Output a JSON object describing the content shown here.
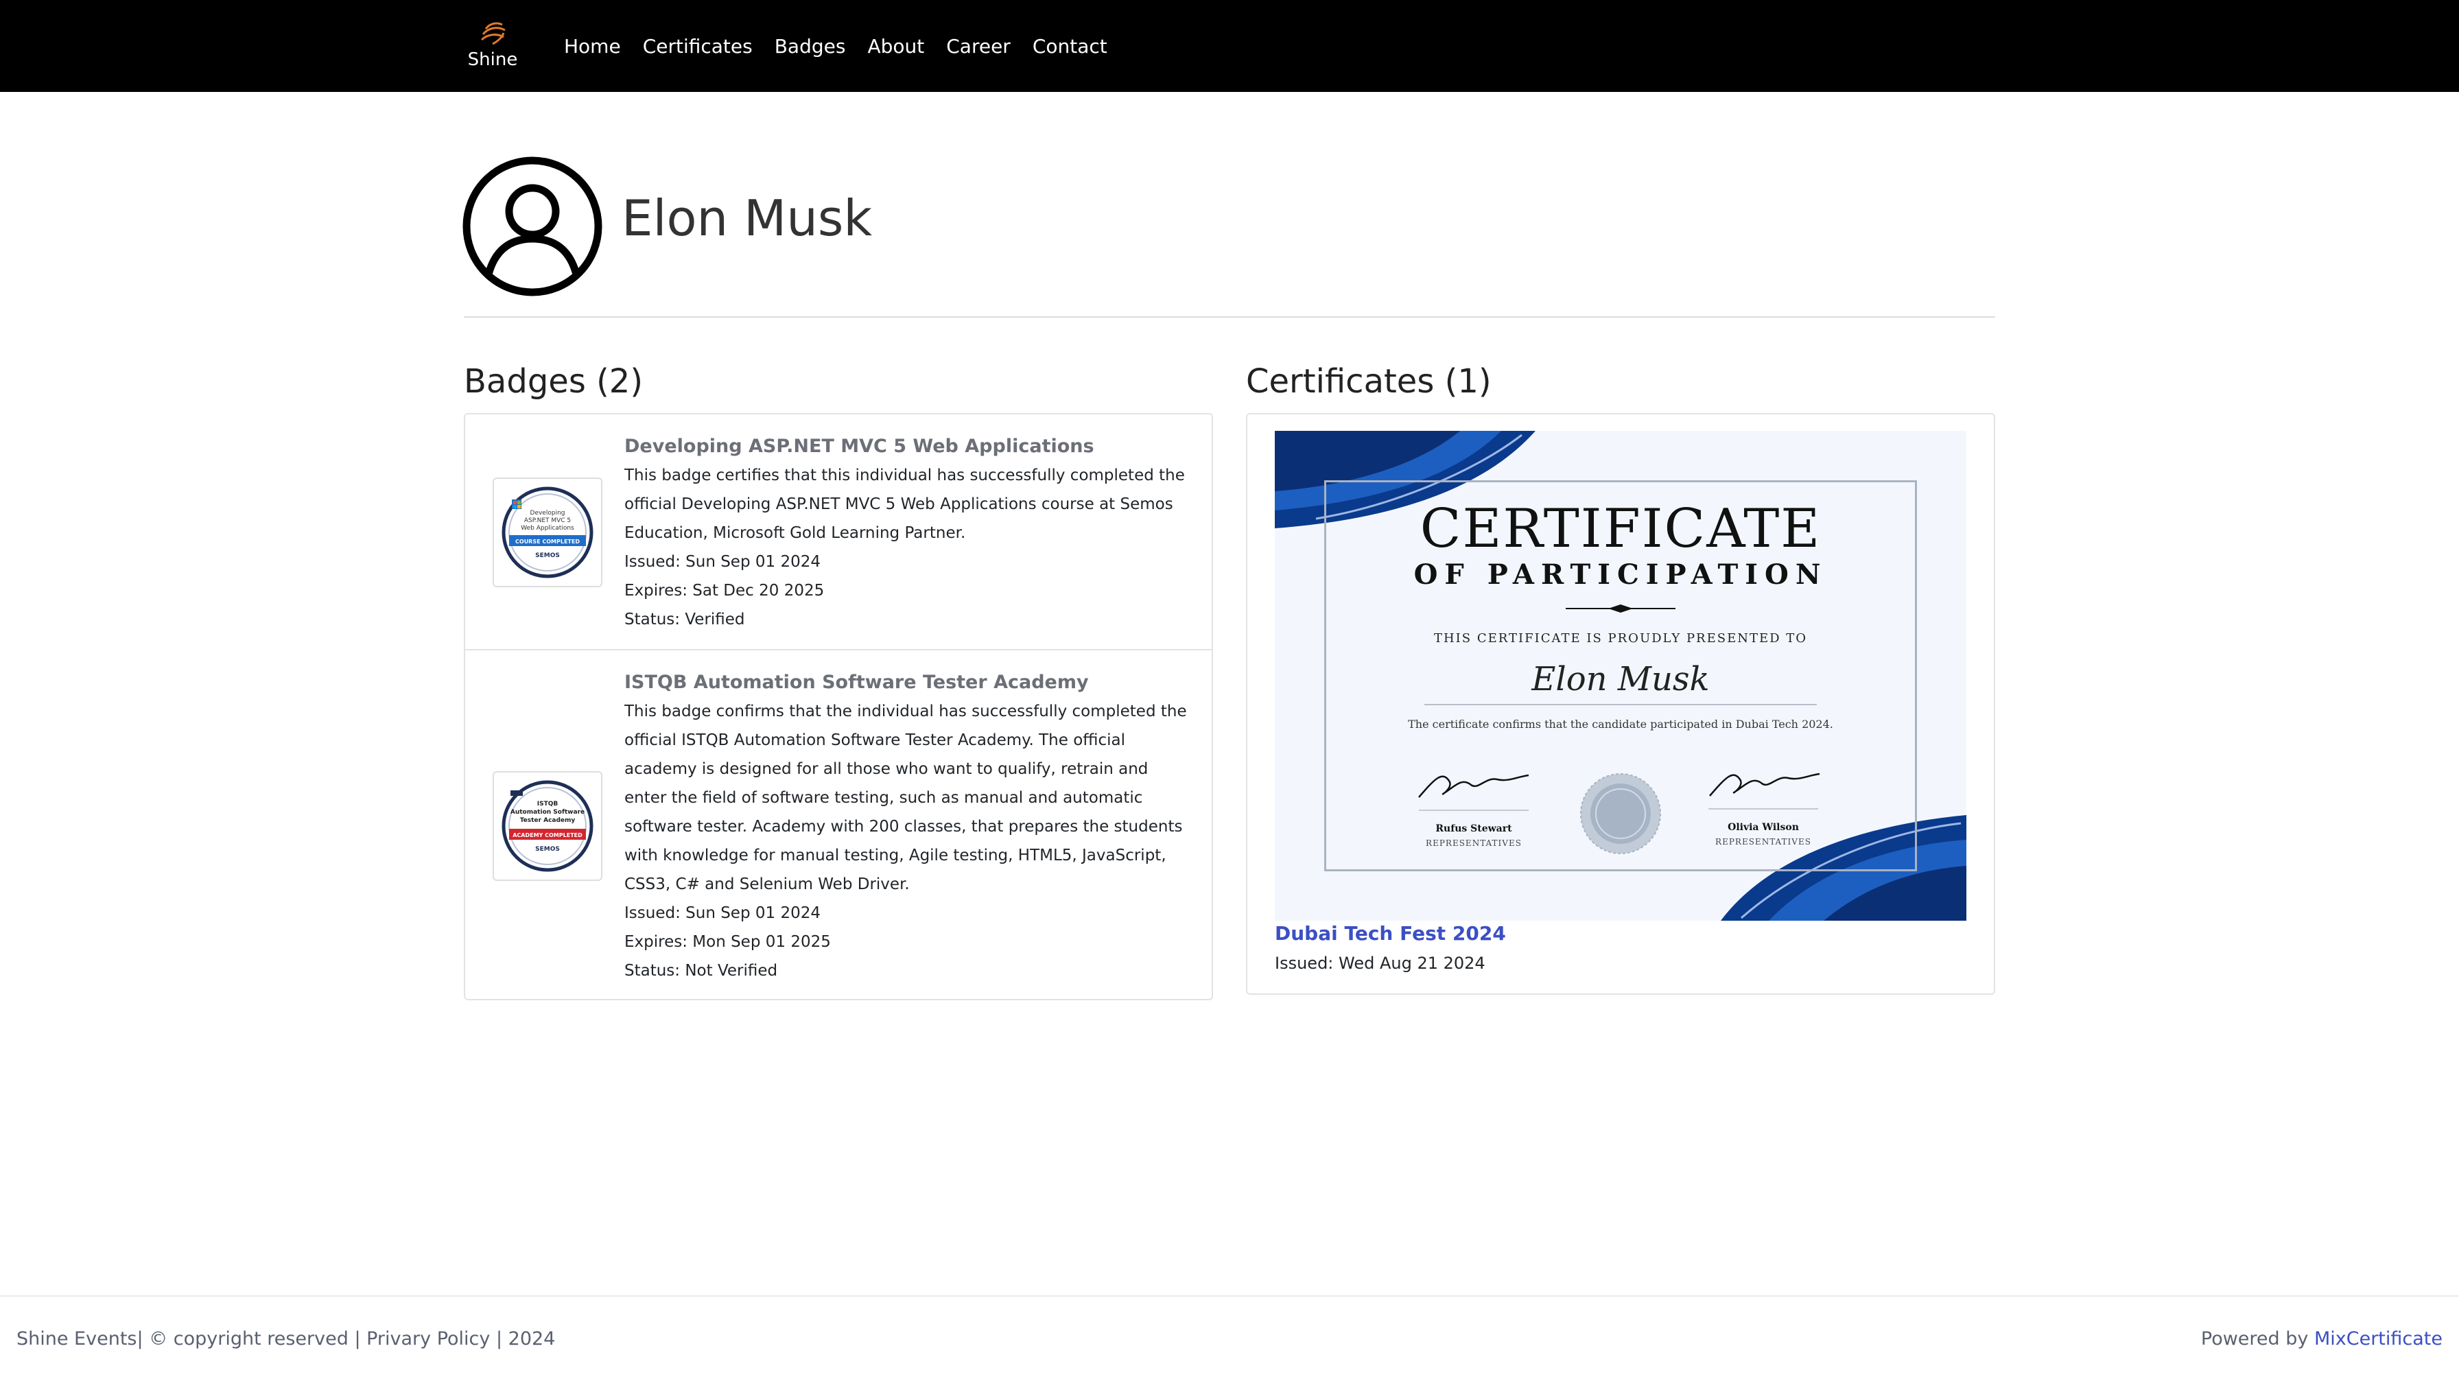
{
  "nav": {
    "brand": "Shine",
    "links": [
      "Home",
      "Certificates",
      "Badges",
      "About",
      "Career",
      "Contact"
    ]
  },
  "profile": {
    "name": "Elon Musk"
  },
  "badges": {
    "heading": "Badges (2)",
    "items": [
      {
        "title": "Developing ASP.NET MVC 5 Web Applications",
        "description": "This badge certifies that this individual has successfully completed the official Developing ASP.NET MVC 5 Web Applications course at Semos Education, Microsoft Gold Learning Partner.",
        "issued": "Issued: Sun Sep 01 2024",
        "expires": "Expires: Sat Dec 20 2025",
        "status": "Status: Verified",
        "image_text": [
          "Developing",
          "ASP.NET MVC 5",
          "Web Applications"
        ],
        "image_band": "COURSE COMPLETED",
        "image_org": "SEMOS",
        "band_color": "#1f6fc9"
      },
      {
        "title": "ISTQB Automation Software Tester Academy",
        "description": "This badge confirms that the individual has successfully completed the official ISTQB Automation Software Tester Academy. The official academy is designed for all those who want to qualify, retrain and enter the field of software testing, such as manual and automatic software tester. Academy with 200 classes, that prepares the students with knowledge for manual testing, Agile testing, HTML5, JavaScript, CSS3, C# and Selenium Web Driver.",
        "issued": "Issued: Sun Sep 01 2024",
        "expires": "Expires: Mon Sep 01 2025",
        "status": "Status: Not Verified",
        "image_text": [
          "ISTQB",
          "Automation Software",
          "Tester Academy"
        ],
        "image_band": "ACADEMY COMPLETED",
        "image_org": "SEMOS",
        "band_color": "#d3262f"
      }
    ]
  },
  "certificates": {
    "heading": "Certificates (1)",
    "items": [
      {
        "image": {
          "title": "CERTIFICATE",
          "subtitle": "OF PARTICIPATION",
          "presented": "THIS CERTIFICATE IS PROUDLY PRESENTED TO",
          "recipient": "Elon Musk",
          "confirm": "The certificate confirms that the candidate participated in Dubai Tech 2024.",
          "signer_left": "Rufus Stewart",
          "signer_right": "Olivia Wilson",
          "role": "REPRESENTATIVES"
        },
        "event": "Dubai Tech Fest 2024",
        "issued": "Issued: Wed Aug 21 2024"
      }
    ]
  },
  "footer": {
    "left": "Shine Events| © copyright reserved | Privary Policy | 2024",
    "powered_prefix": "Powered by",
    "powered_link": "MixCertificate"
  },
  "colors": {
    "navbar": "#000000",
    "link_accent": "#3b4fc4",
    "badge_title": "#6c6f77",
    "cert_blue": "#0a3a8c"
  }
}
